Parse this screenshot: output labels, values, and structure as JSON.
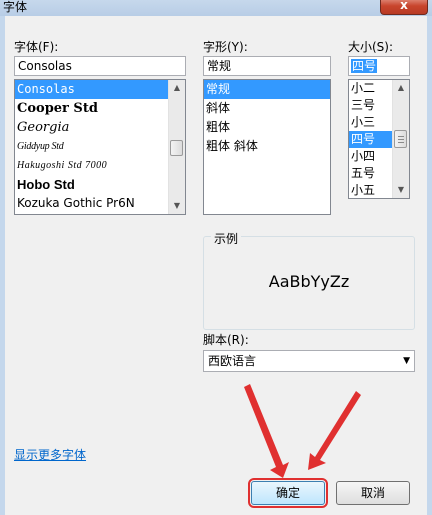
{
  "window": {
    "title": "字体",
    "close_label": "x"
  },
  "font": {
    "label": "字体(F):",
    "value": "Consolas",
    "items": [
      {
        "label": "Consolas",
        "selected": true
      },
      {
        "label": "Cooper Std",
        "selected": false
      },
      {
        "label": "Georgia",
        "selected": false
      },
      {
        "label": "Giddyup Std",
        "selected": false
      },
      {
        "label": "Hakugoshi Std 7000",
        "selected": false
      },
      {
        "label": "Hobo Std",
        "selected": false
      },
      {
        "label": "Kozuka Gothic Pr6N",
        "selected": false
      }
    ]
  },
  "style": {
    "label": "字形(Y):",
    "value": "常规",
    "items": [
      {
        "label": "常规",
        "selected": true
      },
      {
        "label": "斜体",
        "selected": false
      },
      {
        "label": "粗体",
        "selected": false
      },
      {
        "label": "粗体 斜体",
        "selected": false
      }
    ]
  },
  "size": {
    "label": "大小(S):",
    "value": "四号",
    "items": [
      {
        "label": "小二",
        "selected": false
      },
      {
        "label": "三号",
        "selected": false
      },
      {
        "label": "小三",
        "selected": false
      },
      {
        "label": "四号",
        "selected": true
      },
      {
        "label": "小四",
        "selected": false
      },
      {
        "label": "五号",
        "selected": false
      },
      {
        "label": "小五",
        "selected": false
      }
    ]
  },
  "sample": {
    "label": "示例",
    "text": "AaBbYyZz"
  },
  "script": {
    "label": "脚本(R):",
    "value": "西欧语言"
  },
  "more_fonts_link": "显示更多字体",
  "buttons": {
    "ok": "确定",
    "cancel": "取消"
  },
  "colors": {
    "selection": "#3399ff",
    "annotation": "#e03030",
    "link": "#0066cc"
  }
}
